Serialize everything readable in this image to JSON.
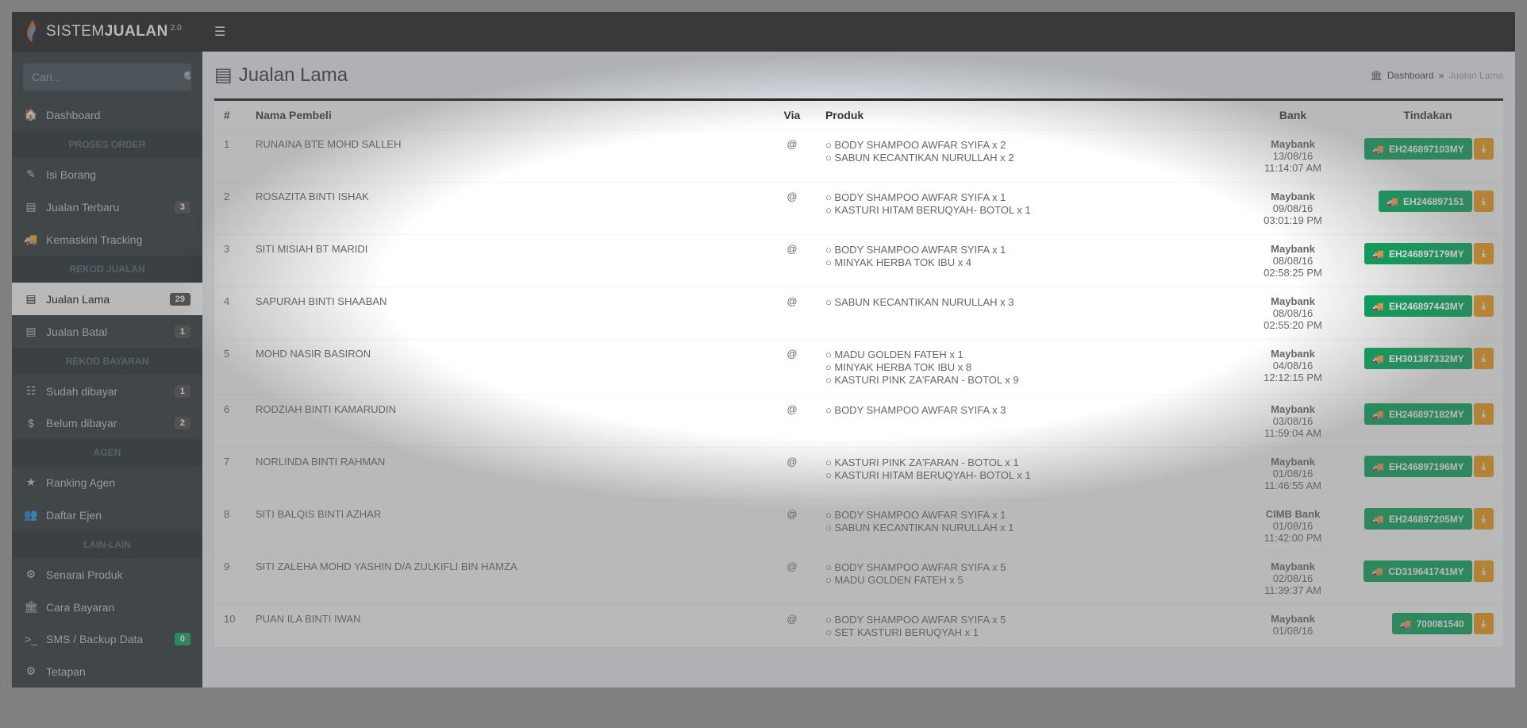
{
  "app": {
    "name_light": "SISTEM",
    "name_bold": "JUALAN",
    "version": "2.0"
  },
  "search": {
    "placeholder": "Cari..."
  },
  "sidebar": {
    "dashboard": {
      "label": "Dashboard"
    },
    "headers": {
      "proses": "PROSES ORDER",
      "rekod": "REKOD JUALAN",
      "bayaran": "REKOD BAYARAN",
      "agen": "AGEN",
      "lain": "LAIN-LAIN"
    },
    "isi_borang": {
      "label": "Isi Borang"
    },
    "jualan_terbaru": {
      "label": "Jualan Terbaru",
      "badge": "3"
    },
    "kemaskini_tracking": {
      "label": "Kemaskini Tracking"
    },
    "jualan_lama": {
      "label": "Jualan Lama",
      "badge": "29"
    },
    "jualan_batal": {
      "label": "Jualan Batal",
      "badge": "1"
    },
    "sudah_dibayar": {
      "label": "Sudah dibayar",
      "badge": "1"
    },
    "belum_dibayar": {
      "label": "Belum dibayar",
      "badge": "2"
    },
    "ranking_agen": {
      "label": "Ranking Agen"
    },
    "daftar_ejen": {
      "label": "Daftar Ejen"
    },
    "senarai_produk": {
      "label": "Senarai Produk"
    },
    "cara_bayaran": {
      "label": "Cara Bayaran"
    },
    "sms_backup": {
      "label": "SMS / Backup Data",
      "badge": "0"
    },
    "tetapan": {
      "label": "Tetapan"
    }
  },
  "page": {
    "title": "Jualan Lama"
  },
  "breadcrumb": {
    "dashboard": "Dashboard",
    "current": "Jualan Lama"
  },
  "table": {
    "headers": {
      "no": "#",
      "nama": "Nama Pembeli",
      "via": "Via",
      "produk": "Produk",
      "bank": "Bank",
      "tindakan": "Tindakan"
    },
    "rows": [
      {
        "no": "1",
        "nama": "RUNAINA BTE MOHD SALLEH",
        "via": "@",
        "produk": [
          "○ BODY SHAMPOO AWFAR SYIFA x 2",
          "○ SABUN KECANTIKAN NURULLAH x 2"
        ],
        "bank": "Maybank",
        "date": "13/08/16",
        "time": "11:14:07 AM",
        "track": "EH246897103MY"
      },
      {
        "no": "2",
        "nama": "ROSAZITA BINTI ISHAK",
        "via": "@",
        "produk": [
          "○ BODY SHAMPOO AWFAR SYIFA x 1",
          "○ KASTURI HITAM BERUQYAH- BOTOL x 1"
        ],
        "bank": "Maybank",
        "date": "09/08/16",
        "time": "03:01:19 PM",
        "track": "EH246897151"
      },
      {
        "no": "3",
        "nama": "SITI MISIAH BT MARIDI",
        "via": "@",
        "produk": [
          "○ BODY SHAMPOO AWFAR SYIFA x 1",
          "○ MINYAK HERBA TOK IBU x 4"
        ],
        "bank": "Maybank",
        "date": "08/08/16",
        "time": "02:58:25 PM",
        "track": "EH246897179MY"
      },
      {
        "no": "4",
        "nama": "SAPURAH BINTI SHAABAN",
        "via": "@",
        "produk": [
          "○ SABUN KECANTIKAN NURULLAH x 3"
        ],
        "bank": "Maybank",
        "date": "08/08/16",
        "time": "02:55:20 PM",
        "track": "EH246897443MY"
      },
      {
        "no": "5",
        "nama": "MOHD NASIR BASIRON",
        "via": "@",
        "produk": [
          "○ MADU GOLDEN FATEH x 1",
          "○ MINYAK HERBA TOK IBU x 8",
          "○ KASTURI PINK ZA'FARAN - BOTOL x 9"
        ],
        "bank": "Maybank",
        "date": "04/08/16",
        "time": "12:12:15 PM",
        "track": "EH301387332MY"
      },
      {
        "no": "6",
        "nama": "RODZIAH BINTI KAMARUDIN",
        "via": "@",
        "produk": [
          "○ BODY SHAMPOO AWFAR SYIFA x 3"
        ],
        "bank": "Maybank",
        "date": "03/08/16",
        "time": "11:59:04 AM",
        "track": "EH246897182MY"
      },
      {
        "no": "7",
        "nama": "NORLINDA BINTI RAHMAN",
        "via": "@",
        "produk": [
          "○ KASTURI PINK ZA'FARAN - BOTOL x 1",
          "○ KASTURI HITAM BERUQYAH- BOTOL x 1"
        ],
        "bank": "Maybank",
        "date": "01/08/16",
        "time": "11:46:55 AM",
        "track": "EH246897196MY"
      },
      {
        "no": "8",
        "nama": "SITI BALQIS BINTI AZHAR",
        "via": "@",
        "produk": [
          "○ BODY SHAMPOO AWFAR SYIFA x 1",
          "○ SABUN KECANTIKAN NURULLAH x 1"
        ],
        "bank": "CIMB Bank",
        "date": "01/08/16",
        "time": "11:42:00 PM",
        "track": "EH246897205MY"
      },
      {
        "no": "9",
        "nama": "SITI ZALEHA MOHD YASHIN D/A ZULKIFLI BIN HAMZA",
        "via": "@",
        "produk": [
          "○ BODY SHAMPOO AWFAR SYIFA x 5",
          "○ MADU GOLDEN FATEH x 5"
        ],
        "bank": "Maybank",
        "date": "02/08/16",
        "time": "11:39:37 AM",
        "track": "CD319641741MY"
      },
      {
        "no": "10",
        "nama": "PUAN ILA BINTI IWAN",
        "via": "@",
        "produk": [
          "○ BODY SHAMPOO AWFAR SYIFA x 5",
          "○ SET KASTURI BERUQYAH x 1"
        ],
        "bank": "Maybank",
        "date": "01/08/16",
        "time": "",
        "track": "700081540"
      }
    ]
  }
}
